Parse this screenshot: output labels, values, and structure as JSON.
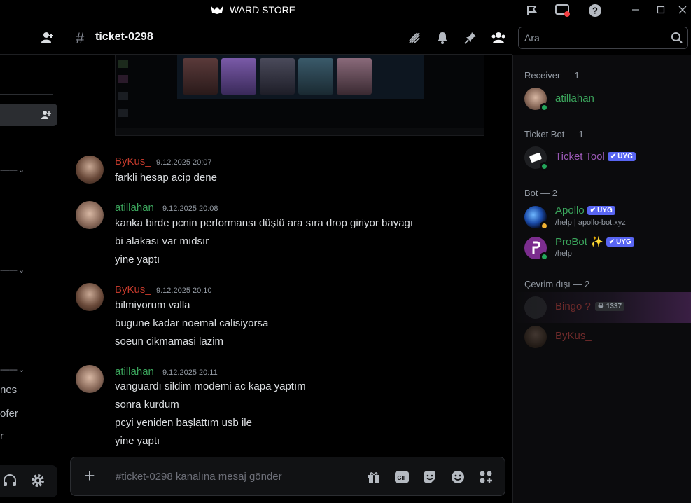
{
  "window": {
    "title": "WARD STORE"
  },
  "channel": {
    "name": "ticket-0298"
  },
  "search": {
    "placeholder": "Ara"
  },
  "left_sidebar": {
    "fragments": [
      "nes",
      "ofer",
      "r"
    ]
  },
  "messages": [
    {
      "author": "ByKus_",
      "author_color": "#c0392b",
      "timestamp": "9.12.2025 20:07",
      "lines": [
        "farkli hesap acip dene"
      ]
    },
    {
      "author": "atillahan",
      "author_color": "#3ba55c",
      "timestamp": "9.12.2025 20:08",
      "lines": [
        "kanka birde pcnin performansı düştü ara sıra drop giriyor bayagı",
        "bi alakası var mıdsır",
        "yine yaptı"
      ]
    },
    {
      "author": "ByKus_",
      "author_color": "#c0392b",
      "timestamp": "9.12.2025 20:10",
      "lines": [
        "bilmiyorum valla",
        "bugune kadar noemal calisiyorsa",
        "soeun cikmamasi lazim"
      ]
    },
    {
      "author": "atillahan",
      "author_color": "#3ba55c",
      "timestamp": "9.12.2025 20:11",
      "lines": [
        "vanguardı sildim modemi ac kapa yaptım",
        "sonra kurdum",
        "pcyi yeniden başlattım usb ile",
        "yine yaptı"
      ]
    }
  ],
  "composer": {
    "placeholder": "#ticket-0298 kanalına mesaj gönder"
  },
  "members": {
    "groups": [
      {
        "title": "Receiver — 1"
      },
      {
        "title": "Ticket Bot — 1"
      },
      {
        "title": "Bot — 2"
      },
      {
        "title": "Çevrim dışı — 2"
      }
    ],
    "list": [
      {
        "name": "atillahan",
        "color": "#3ba55c",
        "sub": ""
      },
      {
        "name": "Ticket Tool",
        "color": "#9b59b6",
        "badge": "UYG",
        "sub": ""
      },
      {
        "name": "Apollo",
        "color": "#3ba55c",
        "badge": "UYG",
        "sub": "/help | apollo-bot.xyz"
      },
      {
        "name": "ProBot",
        "color": "#3ba55c",
        "badge": "UYG",
        "sub": "/help"
      },
      {
        "name": "Bingo ?",
        "color": "#6e2a2a",
        "tag": "1337",
        "sub": ""
      },
      {
        "name": "ByKus_",
        "color": "#6e2a2a",
        "sub": ""
      }
    ]
  },
  "colors": {
    "accent": "#5865f2",
    "online": "#23a55a",
    "background": "#000000"
  }
}
